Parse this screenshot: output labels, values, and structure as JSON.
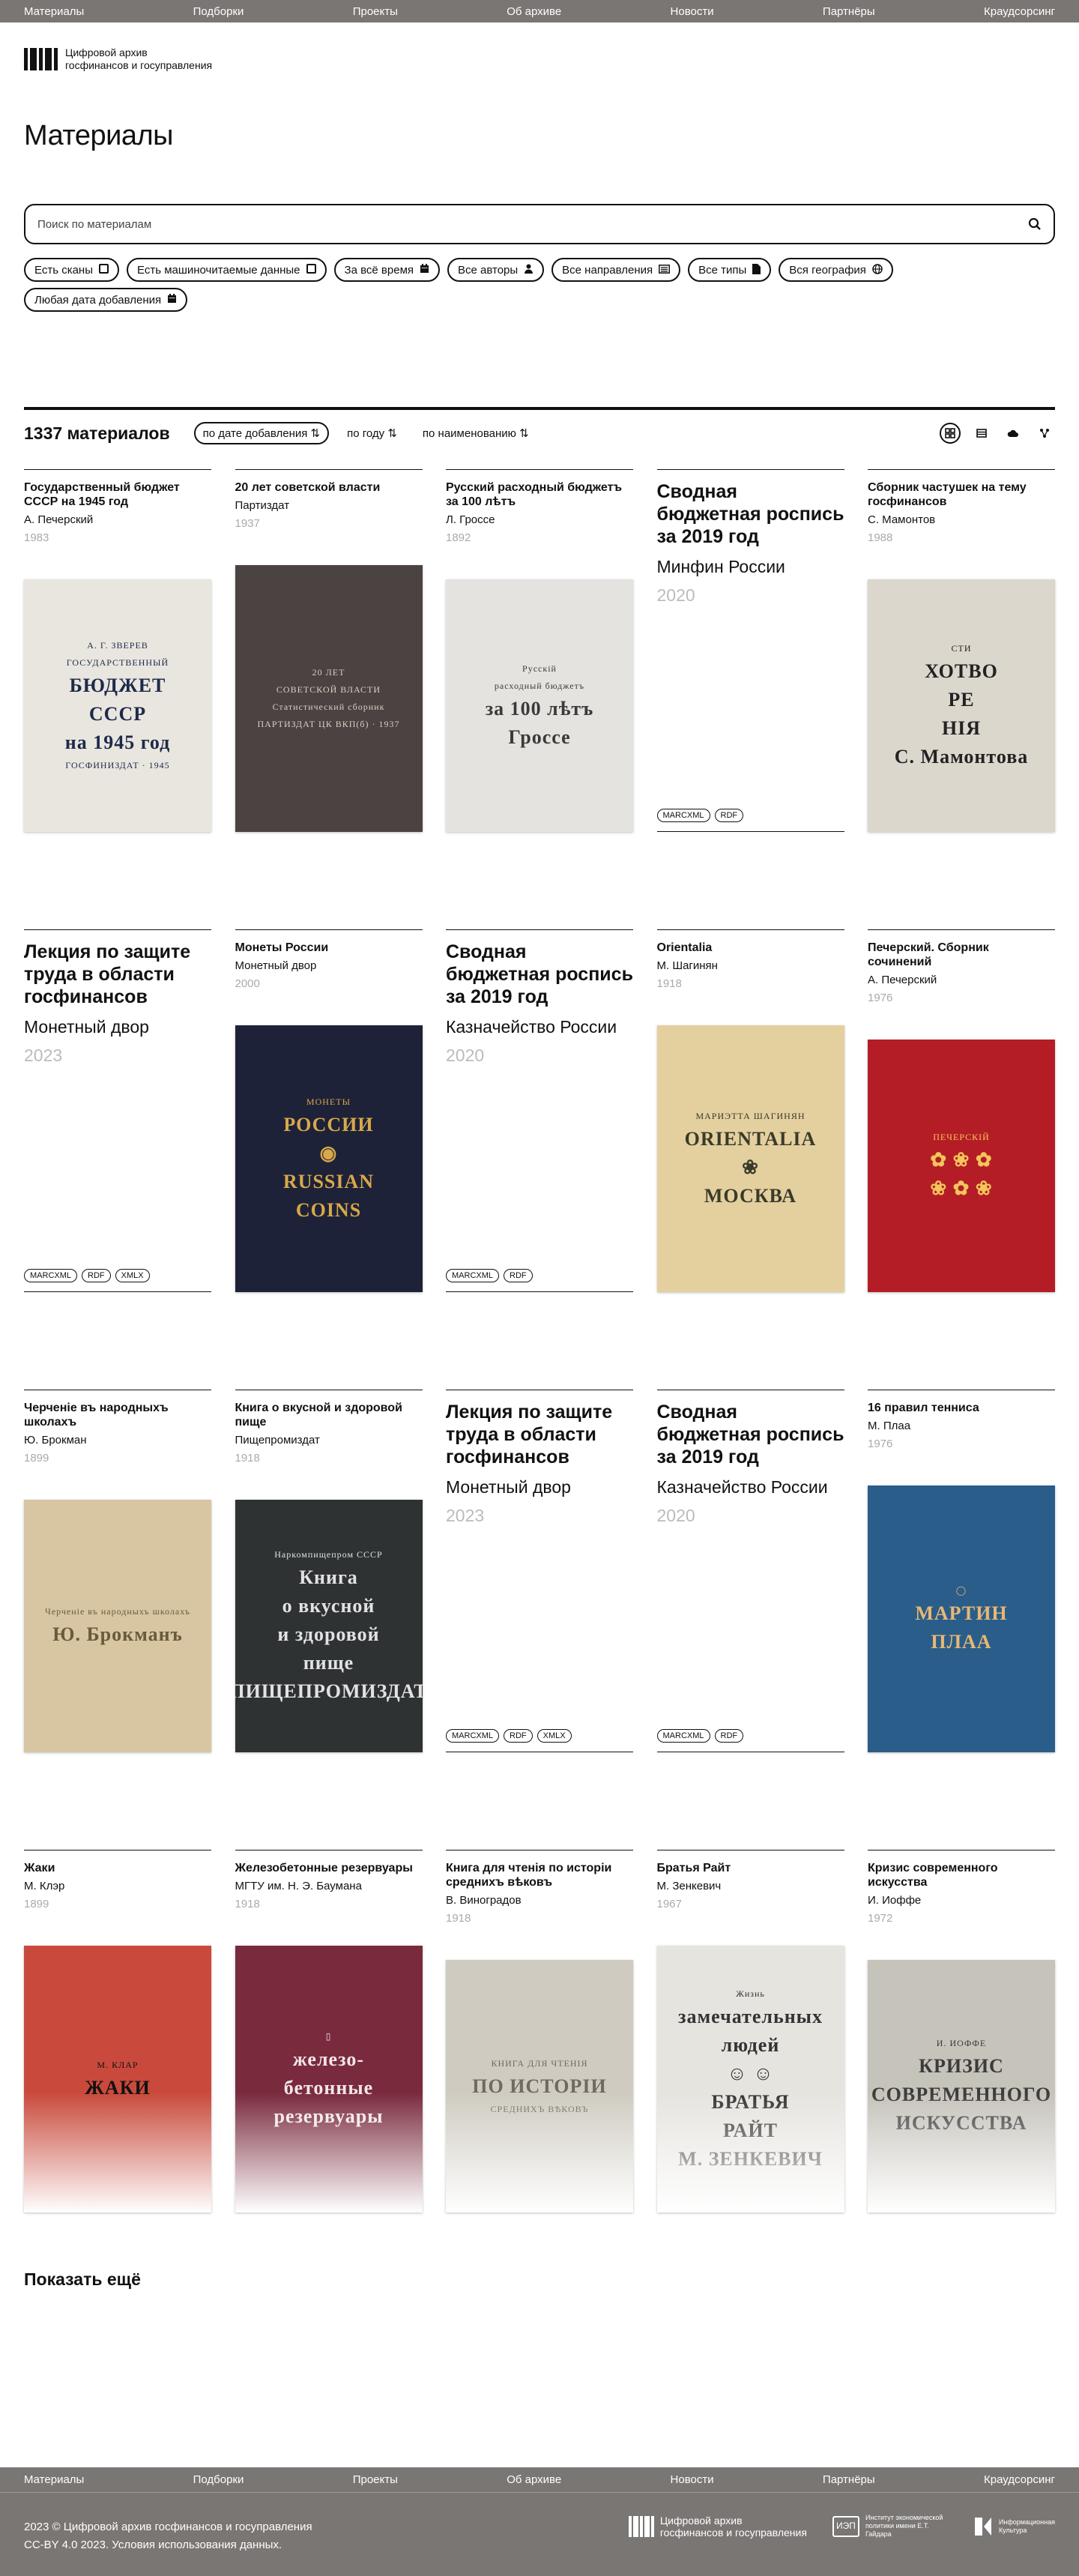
{
  "nav": [
    "Материалы",
    "Подборки",
    "Проекты",
    "Об архиве",
    "Новости",
    "Партнёры",
    "Краудсорсинг"
  ],
  "brand": {
    "line1": "Цифровой архив",
    "line2": "госфинансов и госуправления"
  },
  "page_title": "Материалы",
  "search": {
    "placeholder": "Поиск по материалам"
  },
  "filters": [
    {
      "label": "Есть сканы",
      "icon": "checkbox-icon"
    },
    {
      "label": "Есть машиночитаемые данные",
      "icon": "checkbox-icon"
    },
    {
      "label": "За всё время",
      "icon": "calendar-icon"
    },
    {
      "label": "Все авторы",
      "icon": "person-icon"
    },
    {
      "label": "Все направления",
      "icon": "list-icon"
    },
    {
      "label": "Все типы",
      "icon": "document-icon"
    },
    {
      "label": "Вся география",
      "icon": "globe-icon"
    },
    {
      "label": "Любая дата добавления",
      "icon": "calendar-icon"
    }
  ],
  "results": {
    "count": "1337 материалов",
    "sort": [
      "по дате добавления ⇅",
      "по году ⇅",
      "по наименованию ⇅"
    ],
    "views": [
      "grid-view-icon",
      "table-view-icon",
      "cloud-view-icon",
      "graph-view-icon"
    ]
  },
  "cards": [
    {
      "title": "Государственный бюджет СССР на 1945 год",
      "author": "А. Печерский",
      "year": "1983",
      "cover": {
        "bg": "#e9e6df",
        "fg": "#1d2a4a",
        "lines": [
          "А. Г. ЗВЕРЕВ",
          "ГОСУДАРСТВЕННЫЙ",
          "БЮДЖЕТ",
          "СССР",
          "на 1945 год",
          "ГОСФИНИЗДАТ · 1945"
        ]
      }
    },
    {
      "title": "20 лет советской власти",
      "author": "Партиздат",
      "year": "1937",
      "cover": {
        "bg": "#4b4342",
        "fg": "#d8cfc2",
        "lines": [
          "20 ЛЕТ",
          "СОВЕТСКОЙ ВЛАСТИ",
          "Статистический сборник",
          "ПАРТИЗДАТ ЦК ВКП(б) · 1937"
        ]
      }
    },
    {
      "title": "Русский расходный бюджетъ за 100 лѣтъ",
      "author": "Л. Гроссе",
      "year": "1892",
      "cover": {
        "bg": "#e4e3df",
        "fg": "#3a3a3a",
        "lines": [
          "Русскій",
          "расходный бюджетъ",
          "за 100 лѣтъ",
          "Гроссе"
        ]
      }
    },
    {
      "title": "Сводная бюджетная роспись за 2019 год",
      "author": "Минфин России",
      "year": "2020",
      "text": true,
      "badges": [
        "MARCXML",
        "RDF"
      ]
    },
    {
      "title": "Сборник частушек на тему госфинансов",
      "author": "С. Мамонтов",
      "year": "1988",
      "cover": {
        "bg": "#dcd7cd",
        "fg": "#222",
        "lines": [
          "СТИ",
          "ХОТВО",
          "РЕ",
          "НІЯ",
          "С. Мамонтова"
        ]
      }
    },
    {
      "title": "Лекция по защите труда в области госфинансов",
      "author": "Монетный двор",
      "year": "2023",
      "text": true,
      "badges": [
        "MARCXML",
        "RDF",
        "XMLX"
      ]
    },
    {
      "title": "Монеты России",
      "author": "Монетный двор",
      "year": "2000",
      "cover": {
        "bg": "#1d2238",
        "fg": "#d8a84a",
        "lines": [
          "МОНЕТЫ",
          "РОССИИ",
          "◉",
          "RUSSIAN",
          "COINS"
        ]
      }
    },
    {
      "title": "Сводная бюджетная роспись за 2019 год",
      "author": "Казначейство России",
      "year": "2020",
      "text": true,
      "badges": [
        "MARCXML",
        "RDF"
      ]
    },
    {
      "title": "Orientalia",
      "author": "М. Шагинян",
      "year": "1918",
      "cover": {
        "bg": "#e4cf9f",
        "fg": "#3a3a2a",
        "lines": [
          "МАРИЭТТА ШАГИНЯН",
          "ORIENTALIA",
          "❀",
          "МОСКВА"
        ]
      }
    },
    {
      "title": "Печерский. Сборник сочинений",
      "author": "А. Печерский",
      "year": "1976",
      "cover": {
        "bg": "#b51d26",
        "fg": "#f3c55c",
        "lines": [
          "ПЕЧЕРСКІЙ",
          "✿ ❀ ✿",
          "❀ ✿ ❀"
        ]
      }
    },
    {
      "title": "Черченіе въ народныхъ школахъ",
      "author": "Ю. Брокман",
      "year": "1899",
      "cover": {
        "bg": "#d7c6a1",
        "fg": "#6a5a3e",
        "lines": [
          "Черченіе въ народныхъ школахъ",
          "Ю. Брокманъ"
        ]
      }
    },
    {
      "title": "Книга о вкусной и здоровой пище",
      "author": "Пищепромиздат",
      "year": "1918",
      "cover": {
        "bg": "#2f3233",
        "fg": "#e2e2e2",
        "lines": [
          "Наркомпищепром СССР",
          "Книга",
          "о вкусной",
          "и здоровой",
          "пище",
          "ПИЩЕПРОМИЗДАТ"
        ]
      }
    },
    {
      "title": "Лекция по защите труда в области госфинансов",
      "author": "Монетный двор",
      "year": "2023",
      "text": true,
      "badges": [
        "MARCXML",
        "RDF",
        "XMLX"
      ]
    },
    {
      "title": "Сводная бюджетная роспись за 2019 год",
      "author": "Казначейство России",
      "year": "2020",
      "text": true,
      "badges": [
        "MARCXML",
        "RDF"
      ]
    },
    {
      "title": "16 правил тенниса",
      "author": "М. Плаа",
      "year": "1976",
      "cover": {
        "bg": "#2b5d8a",
        "fg": "#e7b873",
        "lines": [
          "◯",
          "МАРТИН",
          "ПЛАА"
        ]
      }
    },
    {
      "title": "Жаки",
      "author": "М. Клэр",
      "year": "1899",
      "fade": true,
      "cover": {
        "bg": "#c94a3c",
        "fg": "#111",
        "lines": [
          "М. КЛАР",
          "ЖАКИ"
        ]
      }
    },
    {
      "title": "Железобетонные резервуары",
      "author": "МГТУ им. Н. Э. Баумана",
      "year": "1918",
      "fade": true,
      "cover": {
        "bg": "#7a2a3d",
        "fg": "#f1e6ea",
        "lines": [
          "▯",
          "железо-",
          "бетонные",
          "резервуары"
        ]
      }
    },
    {
      "title": "Книга для чтенія по исторіи среднихъ вѣковъ",
      "author": "В. Виноградов",
      "year": "1918",
      "fade": true,
      "cover": {
        "bg": "#cfcbc1",
        "fg": "#6e6a62",
        "lines": [
          "КНИГА ДЛЯ ЧТЕНІЯ",
          "ПО ИСТОРІИ",
          "СРЕДНИХЪ ВѢКОВЪ"
        ]
      }
    },
    {
      "title": "Братья Райт",
      "author": "М. Зенкевич",
      "year": "1967",
      "fade": true,
      "cover": {
        "bg": "#e6e4df",
        "fg": "#333",
        "lines": [
          "Жизнь",
          "замечательных",
          "людей",
          "☺ ☺",
          "БРАТЬЯ",
          "РАЙТ",
          "М. ЗЕНКЕВИЧ"
        ]
      }
    },
    {
      "title": "Кризис современного искусства",
      "author": "И. Иоффе",
      "year": "1972",
      "fade": true,
      "cover": {
        "bg": "#c6c3bb",
        "fg": "#3b3b3b",
        "lines": [
          "И. ИОФФЕ",
          "КРИЗИС",
          "СОВРЕМЕННОГО",
          "ИСКУССТВА"
        ]
      }
    }
  ],
  "show_more": "Показать ещё",
  "footer": {
    "copyright_line1": "2023 © Цифровой архив госфинансов и госуправления",
    "copyright_line2": "CC-BY 4.0 2023. Условия использования данных.",
    "logo_archive_line1": "Цифровой архив",
    "logo_archive_line2": "госфинансов и госуправления",
    "logo_gaidar": "Институт экономической политики имени Е.Т. Гайдара",
    "logo_infoculture_line1": "Информационная",
    "logo_infoculture_line2": "Культура"
  }
}
